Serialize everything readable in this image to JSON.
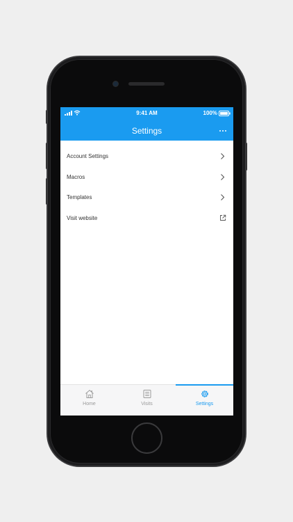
{
  "status_bar": {
    "time": "9:41 AM",
    "battery": "100%"
  },
  "nav": {
    "title": "Settings",
    "more_icon": "more-icon"
  },
  "menu": {
    "items": [
      {
        "label": "Account Settings",
        "icon": "chevron-right-icon"
      },
      {
        "label": "Macros",
        "icon": "chevron-right-icon"
      },
      {
        "label": "Templates",
        "icon": "chevron-right-icon"
      },
      {
        "label": "Visit website",
        "icon": "external-link-icon"
      }
    ]
  },
  "tabbar": {
    "tabs": [
      {
        "label": "Home",
        "icon": "home-icon",
        "active": false
      },
      {
        "label": "Visits",
        "icon": "list-icon",
        "active": false
      },
      {
        "label": "Settings",
        "icon": "gear-icon",
        "active": true
      }
    ]
  },
  "colors": {
    "accent": "#1a9bf0",
    "inactive": "#9a9a9a",
    "background": "#efefef"
  }
}
